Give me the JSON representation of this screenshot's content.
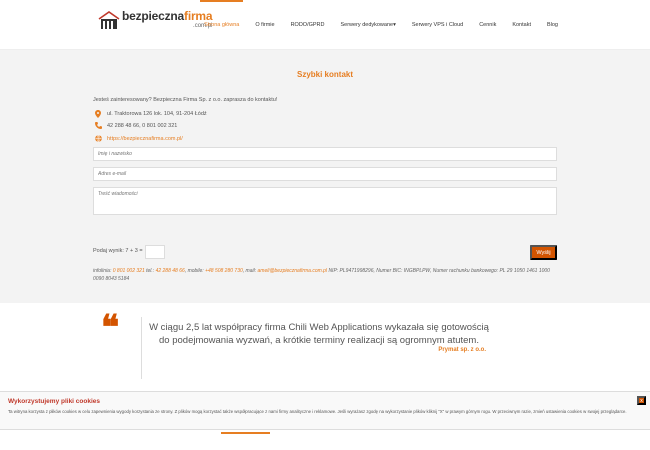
{
  "header": {
    "logo": {
      "main_prefix": "bezpieczna",
      "main_accent": "firma",
      "sub": ".com.pl"
    },
    "nav": [
      {
        "label": "Strona główna",
        "active": true
      },
      {
        "label": "O firmie"
      },
      {
        "label": "RODO/GPRD"
      },
      {
        "label": "Serwery dedykowane▾"
      },
      {
        "label": "Serwery VPS i Cloud"
      },
      {
        "label": "Cennik"
      },
      {
        "label": "Kontakt"
      },
      {
        "label": "Blog"
      }
    ]
  },
  "contact": {
    "title": "Szybki kontakt",
    "intro": "Jesteś zainteresowany? Bezpieczna Firma Sp. z o.o. zaprasza do kontaktu!",
    "address": "ul. Traktorowa 126 lok. 104, 91-204 Łódź",
    "phone": "42 288 48 66, 0 801 002 321",
    "website": "https://bezpiecznafirma.com.pl/",
    "name_placeholder": "Imię i nazwisko",
    "email_placeholder": "Adres e-mail",
    "message_placeholder": "Treść wiadomości",
    "captcha_label": "Podaj wynik: 7 + 3 =",
    "send_label": "Wyślij",
    "footer": {
      "infolinia_label": "infolinia:",
      "infolinia": "0 801 002 321",
      "tel_label": "tel.:",
      "tel": "42 288 48 66",
      "mobile_label": "mobile:",
      "mobile": "+48 508 280 730",
      "mail_label": "mail:",
      "mail": "ameli@bezpiecznafirma.com.pl",
      "rest": "NIP: PL9471998296, Numer BIC: INGBPLPW, Numer rachunku bankowego: PL 29 1050 1461 1000 0090 8043 5184"
    }
  },
  "testimonial": {
    "quote": "W ciągu 2,5 lat współpracy firma Chili Web Applications wykazała się gotowością do podejmowania wyzwań, a krótkie terminy realizacji są ogromnym atutem.",
    "author": "Prymat sp. z o.o."
  },
  "cookie": {
    "title": "Wykorzystujemy pliki cookies",
    "text": "Ta witryna korzysta z plików cookies w celu zapewnienia wygody korzystania ze strony. Z plików mogą korzystać także współpracujące z nami firmy analityczne i reklamowe. Jeśli wyrażasz zgodę na wykorzystanie plików kliknij \"X\" w prawym górnym rogu. W przeciwnym razie, zmień ustawienia cookies w swojej przeglądarce.",
    "close_label": "x"
  },
  "colors": {
    "accent": "#e67e22",
    "button": "#d35400",
    "cookie_title": "#c0392b"
  }
}
